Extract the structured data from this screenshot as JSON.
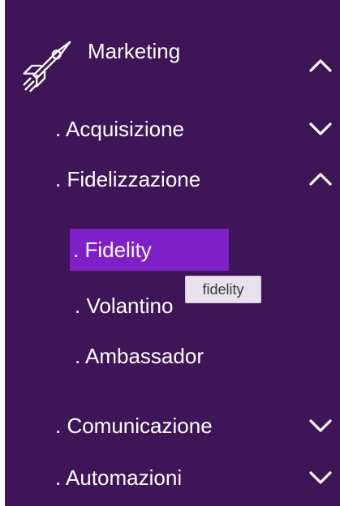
{
  "menu": {
    "title": "Marketing",
    "items": [
      {
        "label": ". Acquisizione"
      },
      {
        "label": ". Fidelizzazione"
      },
      {
        "label": ". Comunicazione"
      },
      {
        "label": ". Automazioni"
      }
    ],
    "subitems": [
      {
        "label": ". Fidelity"
      },
      {
        "label": ". Volantino"
      },
      {
        "label": ". Ambassador"
      }
    ],
    "tooltip": "fidelity",
    "icons": {
      "logo": "rocket-icon",
      "expanded": "chevron-up-icon",
      "collapsed": "chevron-down-icon"
    },
    "colors": {
      "sidebar_bg": "#3e1657",
      "active_bg": "#7f1fc8",
      "tooltip_bg": "#e7e2ec",
      "text": "#ffffff"
    }
  }
}
